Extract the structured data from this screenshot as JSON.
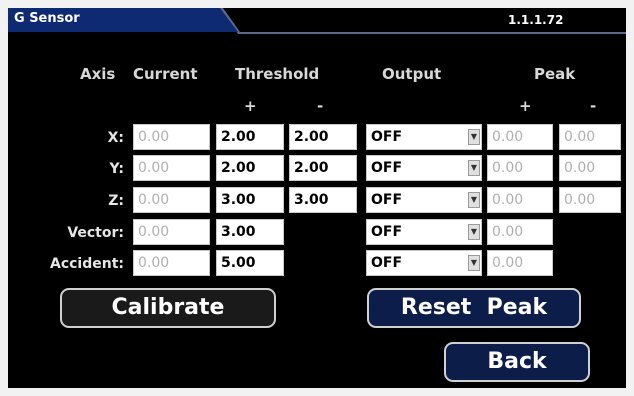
{
  "window": {
    "title": "G Sensor",
    "version": "1.1.1.72"
  },
  "headers": {
    "axis": "Axis",
    "current": "Current",
    "threshold": "Threshold",
    "output": "Output",
    "peak": "Peak",
    "threshold_plus": "+",
    "threshold_minus": "-",
    "peak_plus": "+",
    "peak_minus": "-"
  },
  "rows": [
    {
      "label": "X:",
      "current": "0.00",
      "threshold_plus": "2.00",
      "threshold_minus": "2.00",
      "output": "OFF",
      "peak_plus": "0.00",
      "peak_minus": "0.00"
    },
    {
      "label": "Y:",
      "current": "0.00",
      "threshold_plus": "2.00",
      "threshold_minus": "2.00",
      "output": "OFF",
      "peak_plus": "0.00",
      "peak_minus": "0.00"
    },
    {
      "label": "Z:",
      "current": "0.00",
      "threshold_plus": "3.00",
      "threshold_minus": "3.00",
      "output": "OFF",
      "peak_plus": "0.00",
      "peak_minus": "0.00"
    },
    {
      "label": "Vector:",
      "current": "0.00",
      "threshold_plus": "3.00",
      "output": "OFF",
      "peak_plus": "0.00"
    },
    {
      "label": "Accident:",
      "current": "0.00",
      "threshold_plus": "5.00",
      "output": "OFF",
      "peak_plus": "0.00"
    }
  ],
  "buttons": {
    "calibrate": "Calibrate",
    "reset_peak": "Reset  Peak",
    "back": "Back"
  },
  "icons": {
    "dropdown": "dropdown-arrow-icon"
  },
  "colors": {
    "title_tab": "#0e2a73",
    "button_blue": "#0d1d4a",
    "background": "#000000"
  }
}
